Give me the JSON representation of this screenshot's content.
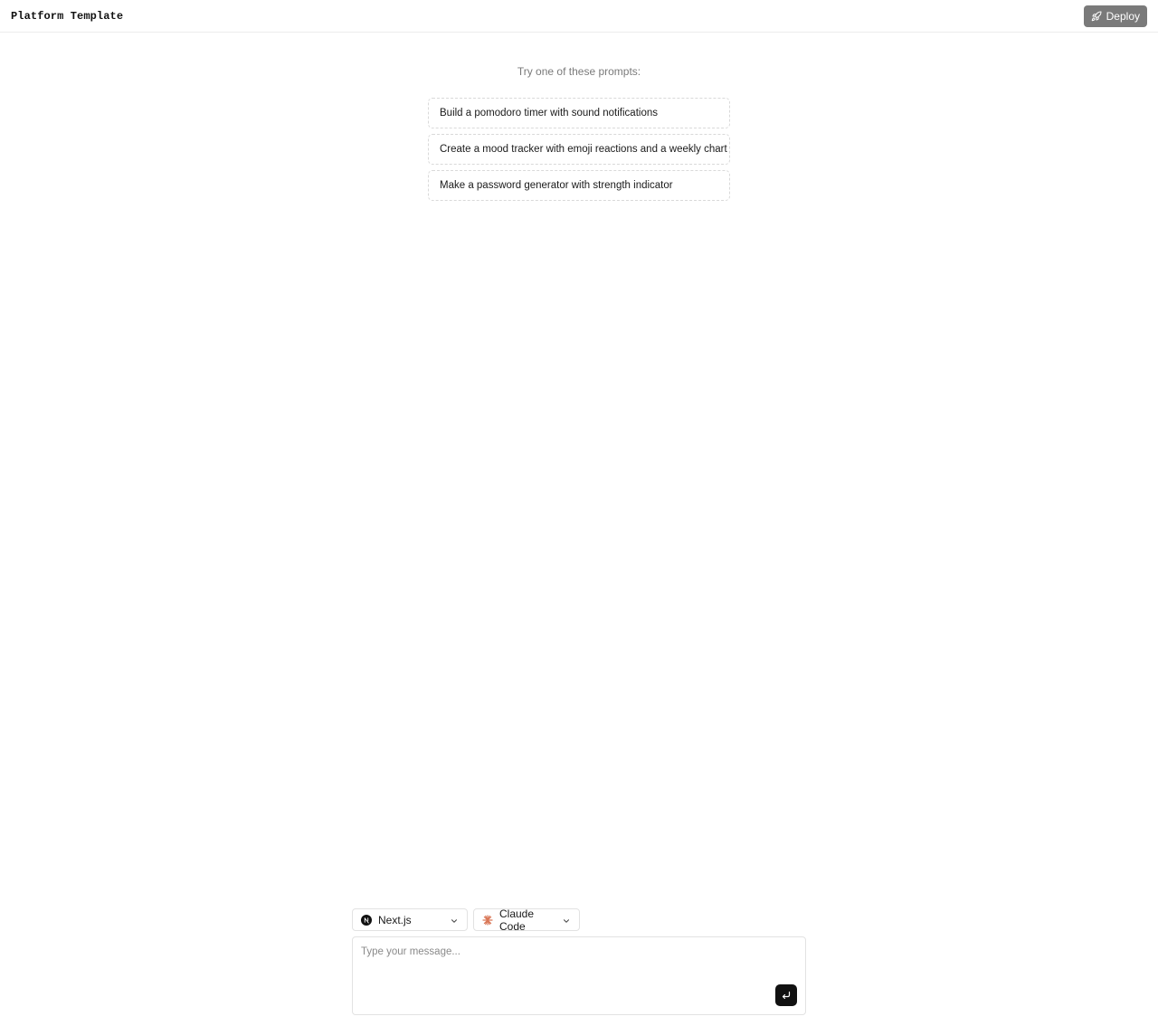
{
  "header": {
    "title": "Platform Template",
    "deploy_label": "Deploy",
    "deploy_icon": "rocket-icon"
  },
  "prompts": {
    "heading": "Try one of these prompts:",
    "items": [
      "Build a pomodoro timer with sound notifications",
      "Create a mood tracker with emoji reactions and a weekly chart",
      "Make a password generator with strength indicator"
    ]
  },
  "composer": {
    "framework": {
      "label": "Next.js",
      "icon": "nextjs-icon"
    },
    "agent": {
      "label": "Claude Code",
      "icon": "claude-icon",
      "accent": "#d97757"
    },
    "placeholder": "Type your message...",
    "send_icon": "enter-icon"
  }
}
